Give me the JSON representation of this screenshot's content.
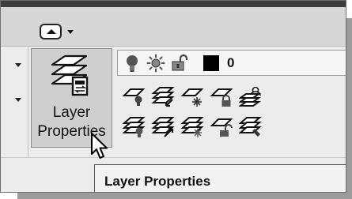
{
  "ribbon": {
    "panel_button": {
      "label_line1": "Layer",
      "label_line2": "Properties"
    },
    "layer_control": {
      "current_layer": "0",
      "current_color": "#000000"
    }
  },
  "tooltip": {
    "title": "Layer Properties"
  }
}
